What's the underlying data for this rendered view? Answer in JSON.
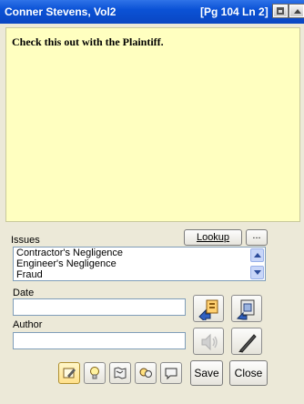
{
  "window": {
    "title": "Conner Stevens, Vol2",
    "location": "[Pg 104 Ln 2]"
  },
  "note": {
    "text": "Check this out with the Plaintiff."
  },
  "issues": {
    "label": "Issues",
    "lookup_label": "Lookup",
    "more_label": "...",
    "items": [
      "Contractor's Negligence",
      "Engineer's Negligence",
      "Fraud"
    ]
  },
  "date": {
    "label": "Date",
    "value": ""
  },
  "author": {
    "label": "Author",
    "value": ""
  },
  "buttons": {
    "save_label": "Save",
    "close_label": "Close"
  },
  "icons": {
    "edit": "edit-note-icon",
    "idea": "lightbulb-icon",
    "map": "map-icon",
    "search": "search-docs-icon",
    "comment": "comment-icon",
    "copy_to": "copy-to-icon",
    "paste_from": "paste-from-icon",
    "speaker": "speaker-icon",
    "pen": "pen-icon"
  },
  "colors": {
    "titlebar": "#0b52d6",
    "note_background": "#ffffc0",
    "panel_background": "#ece9d8"
  }
}
